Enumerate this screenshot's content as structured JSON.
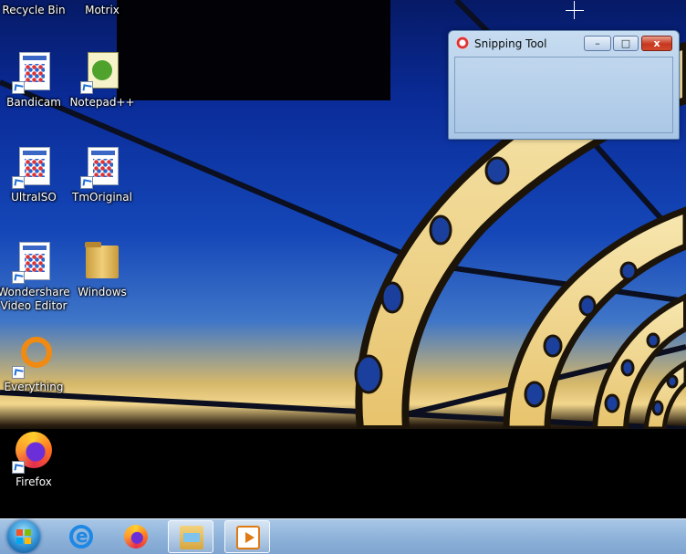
{
  "desktop": {
    "icons": [
      {
        "label": "Recycle Bin"
      },
      {
        "label": "Motrix"
      },
      {
        "label": "Bandicam"
      },
      {
        "label": "Notepad++"
      },
      {
        "label": "UltraISO"
      },
      {
        "label": "TmOriginal"
      },
      {
        "label": "Wondershare\nVideo Editor"
      },
      {
        "label": "Windows"
      },
      {
        "label": "Everything"
      },
      {
        "label": "Firefox"
      }
    ]
  },
  "snipping_tool": {
    "title": "Snipping Tool",
    "minimize_glyph": "–",
    "maximize_glyph": "□",
    "close_glyph": "x"
  },
  "taskbar": {
    "items": [
      "start-orb-icon",
      "internet-explorer-icon",
      "firefox-icon",
      "file-explorer-icon",
      "media-player-icon"
    ]
  }
}
